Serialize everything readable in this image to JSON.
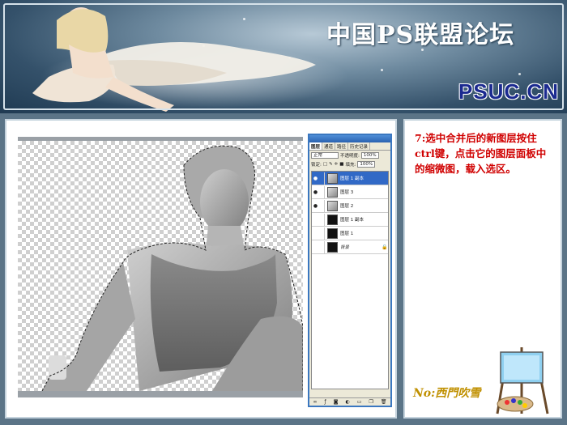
{
  "banner": {
    "title": "中国PS联盟论坛",
    "logo": "PSUC.CN"
  },
  "instruction": {
    "text": "7:选中合并后的新图层按住ctrl键，点击它的图层面板中的缩微图，载入选区。"
  },
  "signature": {
    "text": "No:西門吹雪"
  },
  "layers_palette": {
    "tabs": [
      "图层",
      "通道",
      "路径",
      "历史记录"
    ],
    "blend_mode": "正常",
    "opacity_label": "不透明度:",
    "opacity_value": "100%",
    "lock_label": "锁定:",
    "fill_label": "填充:",
    "fill_value": "100%",
    "layers": [
      {
        "name": "图层 1 副本",
        "visible": true,
        "selected": true,
        "thumb": "gray"
      },
      {
        "name": "图层 3",
        "visible": true,
        "selected": false,
        "thumb": "gray"
      },
      {
        "name": "图层 2",
        "visible": true,
        "selected": false,
        "thumb": "gray"
      },
      {
        "name": "图层 1 副本",
        "visible": false,
        "selected": false,
        "thumb": "black"
      },
      {
        "name": "图层 1",
        "visible": false,
        "selected": false,
        "thumb": "black"
      },
      {
        "name": "背景",
        "visible": false,
        "selected": false,
        "thumb": "black",
        "locked": true
      }
    ]
  },
  "colors": {
    "instruction_text": "#d00000",
    "selected_layer": "#3169c6",
    "logo_text": "#1b2a90"
  }
}
